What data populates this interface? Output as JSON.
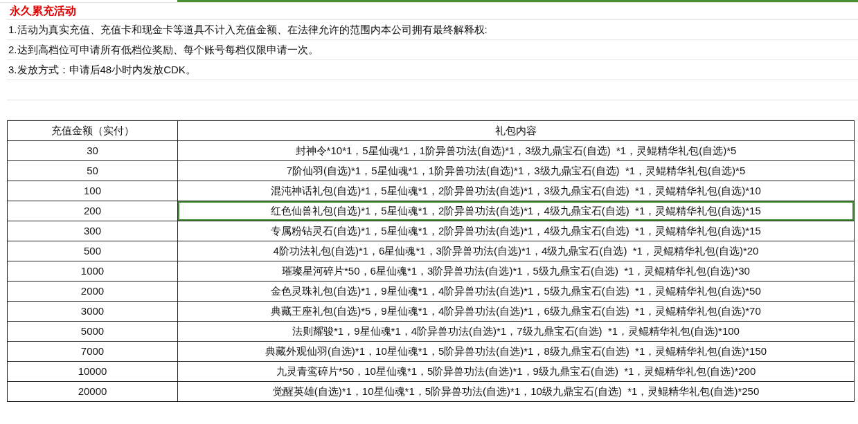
{
  "title": "永久累充活动",
  "notes": [
    "1.活动为真实充值、充值卡和现金卡等道具不计入充值金额、在法律允许的范围内本公司拥有最终解释权:",
    "2.达到高档位可申请所有低档位奖励、每个账号每档仅限申请一次。",
    "3.发放方式：申请后48小时内发放CDK。"
  ],
  "table": {
    "columns": [
      "充值金额（实付）",
      "礼包内容"
    ],
    "rows": [
      {
        "amount": "30",
        "contents": "封神令*10*1，5星仙魂*1，1阶异兽功法(自选)*1，3级九鼎宝石(自选)  *1，灵鲲精华礼包(自选)*5",
        "selected": false
      },
      {
        "amount": "50",
        "contents": "7阶仙羽(自选)*1，5星仙魂*1，1阶异兽功法(自选)*1，3级九鼎宝石(自选)  *1，灵鲲精华礼包(自选)*5",
        "selected": false
      },
      {
        "amount": "100",
        "contents": "混沌神话礼包(自选)*1，5星仙魂*1，2阶异兽功法(自选)*1，3级九鼎宝石(自选)  *1，灵鲲精华礼包(自选)*10",
        "selected": false
      },
      {
        "amount": "200",
        "contents": "红色仙兽礼包(自选)*1，5星仙魂*1，2阶异兽功法(自选)*1，4级九鼎宝石(自选)  *1，灵鲲精华礼包(自选)*15",
        "selected": true
      },
      {
        "amount": "300",
        "contents": "专属粉钻灵石(自选)*1，5星仙魂*1，2阶异兽功法(自选)*1，4级九鼎宝石(自选)  *1，灵鲲精华礼包(自选)*15",
        "selected": false
      },
      {
        "amount": "500",
        "contents": "4阶功法礼包(自选)*1，6星仙魂*1，3阶异兽功法(自选)*1，4级九鼎宝石(自选)  *1，灵鲲精华礼包(自选)*20",
        "selected": false
      },
      {
        "amount": "1000",
        "contents": "璀璨星河碎片*50，6星仙魂*1，3阶异兽功法(自选)*1，5级九鼎宝石(自选)  *1，灵鲲精华礼包(自选)*30",
        "selected": false
      },
      {
        "amount": "2000",
        "contents": "金色灵珠礼包(自选)*1，9星仙魂*1，4阶异兽功法(自选)*1，5级九鼎宝石(自选)  *1，灵鲲精华礼包(自选)*50",
        "selected": false
      },
      {
        "amount": "3000",
        "contents": "典藏王座礼包(自选)*5，9星仙魂*1，4阶异兽功法(自选)*1，6级九鼎宝石(自选)  *1，灵鲲精华礼包(自选)*70",
        "selected": false
      },
      {
        "amount": "5000",
        "contents": "法则耀骏*1，9星仙魂*1，4阶异兽功法(自选)*1，7级九鼎宝石(自选)  *1，灵鲲精华礼包(自选)*100",
        "selected": false
      },
      {
        "amount": "7000",
        "contents": "典藏外观仙羽(自选)*1，10星仙魂*1，5阶异兽功法(自选)*1，8级九鼎宝石(自选)  *1，灵鲲精华礼包(自选)*150",
        "selected": false
      },
      {
        "amount": "10000",
        "contents": "九灵青鸾碎片*50，10星仙魂*1，5阶异兽功法(自选)*1，9级九鼎宝石(自选)  *1，灵鲲精华礼包(自选)*200",
        "selected": false
      },
      {
        "amount": "20000",
        "contents": "觉醒英雄(自选)*1，10星仙魂*1，5阶异兽功法(自选)*1，10级九鼎宝石(自选)  *1，灵鲲精华礼包(自选)*250",
        "selected": false
      }
    ]
  }
}
